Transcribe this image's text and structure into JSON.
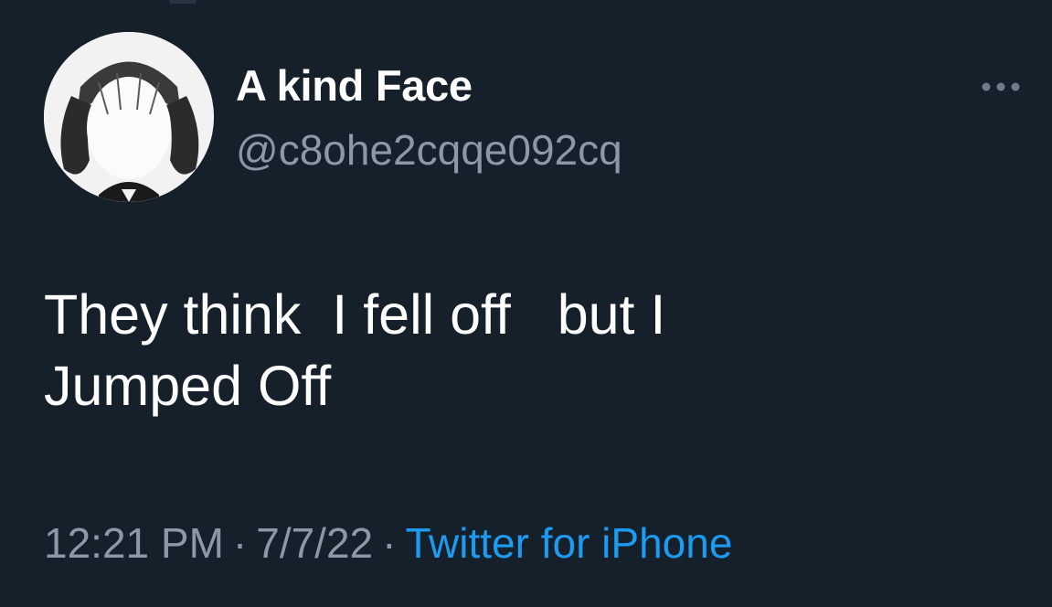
{
  "tweet": {
    "author": {
      "display_name": "A kind Face",
      "handle": "@c8ohe2cqqe092cq"
    },
    "text": "They think  I fell off   but I\nJumped Off",
    "time": "12:21 PM",
    "date": "7/7/22",
    "separator": "·",
    "source": "Twitter for iPhone",
    "icons": {
      "avatar": "avatar-photo",
      "more": "more-horizontal-icon"
    },
    "colors": {
      "background": "#15202b",
      "primary_text": "#ffffff",
      "secondary_text": "#8b98a5",
      "link": "#1d9bf0"
    }
  }
}
